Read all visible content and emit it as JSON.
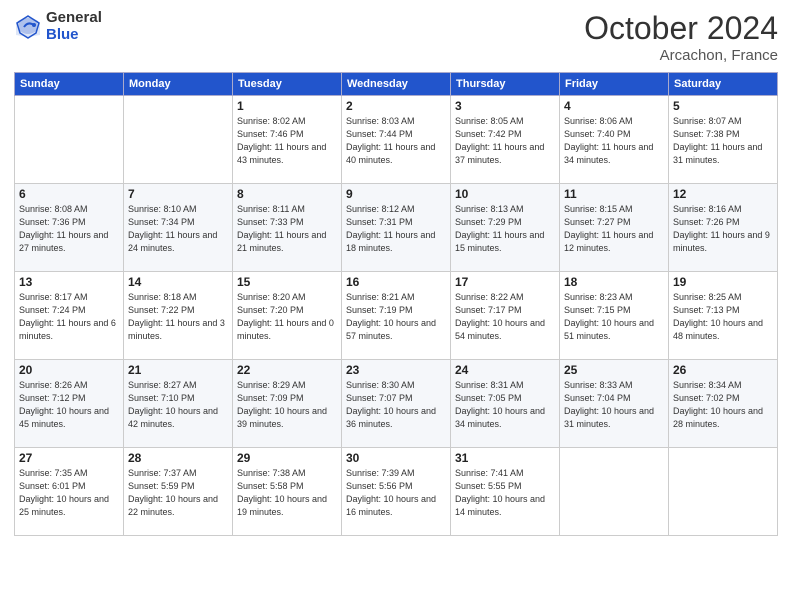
{
  "header": {
    "logo_general": "General",
    "logo_blue": "Blue",
    "month": "October 2024",
    "location": "Arcachon, France"
  },
  "days_of_week": [
    "Sunday",
    "Monday",
    "Tuesday",
    "Wednesday",
    "Thursday",
    "Friday",
    "Saturday"
  ],
  "weeks": [
    [
      {
        "day": "",
        "detail": ""
      },
      {
        "day": "",
        "detail": ""
      },
      {
        "day": "1",
        "detail": "Sunrise: 8:02 AM\nSunset: 7:46 PM\nDaylight: 11 hours and 43 minutes."
      },
      {
        "day": "2",
        "detail": "Sunrise: 8:03 AM\nSunset: 7:44 PM\nDaylight: 11 hours and 40 minutes."
      },
      {
        "day": "3",
        "detail": "Sunrise: 8:05 AM\nSunset: 7:42 PM\nDaylight: 11 hours and 37 minutes."
      },
      {
        "day": "4",
        "detail": "Sunrise: 8:06 AM\nSunset: 7:40 PM\nDaylight: 11 hours and 34 minutes."
      },
      {
        "day": "5",
        "detail": "Sunrise: 8:07 AM\nSunset: 7:38 PM\nDaylight: 11 hours and 31 minutes."
      }
    ],
    [
      {
        "day": "6",
        "detail": "Sunrise: 8:08 AM\nSunset: 7:36 PM\nDaylight: 11 hours and 27 minutes."
      },
      {
        "day": "7",
        "detail": "Sunrise: 8:10 AM\nSunset: 7:34 PM\nDaylight: 11 hours and 24 minutes."
      },
      {
        "day": "8",
        "detail": "Sunrise: 8:11 AM\nSunset: 7:33 PM\nDaylight: 11 hours and 21 minutes."
      },
      {
        "day": "9",
        "detail": "Sunrise: 8:12 AM\nSunset: 7:31 PM\nDaylight: 11 hours and 18 minutes."
      },
      {
        "day": "10",
        "detail": "Sunrise: 8:13 AM\nSunset: 7:29 PM\nDaylight: 11 hours and 15 minutes."
      },
      {
        "day": "11",
        "detail": "Sunrise: 8:15 AM\nSunset: 7:27 PM\nDaylight: 11 hours and 12 minutes."
      },
      {
        "day": "12",
        "detail": "Sunrise: 8:16 AM\nSunset: 7:26 PM\nDaylight: 11 hours and 9 minutes."
      }
    ],
    [
      {
        "day": "13",
        "detail": "Sunrise: 8:17 AM\nSunset: 7:24 PM\nDaylight: 11 hours and 6 minutes."
      },
      {
        "day": "14",
        "detail": "Sunrise: 8:18 AM\nSunset: 7:22 PM\nDaylight: 11 hours and 3 minutes."
      },
      {
        "day": "15",
        "detail": "Sunrise: 8:20 AM\nSunset: 7:20 PM\nDaylight: 11 hours and 0 minutes."
      },
      {
        "day": "16",
        "detail": "Sunrise: 8:21 AM\nSunset: 7:19 PM\nDaylight: 10 hours and 57 minutes."
      },
      {
        "day": "17",
        "detail": "Sunrise: 8:22 AM\nSunset: 7:17 PM\nDaylight: 10 hours and 54 minutes."
      },
      {
        "day": "18",
        "detail": "Sunrise: 8:23 AM\nSunset: 7:15 PM\nDaylight: 10 hours and 51 minutes."
      },
      {
        "day": "19",
        "detail": "Sunrise: 8:25 AM\nSunset: 7:13 PM\nDaylight: 10 hours and 48 minutes."
      }
    ],
    [
      {
        "day": "20",
        "detail": "Sunrise: 8:26 AM\nSunset: 7:12 PM\nDaylight: 10 hours and 45 minutes."
      },
      {
        "day": "21",
        "detail": "Sunrise: 8:27 AM\nSunset: 7:10 PM\nDaylight: 10 hours and 42 minutes."
      },
      {
        "day": "22",
        "detail": "Sunrise: 8:29 AM\nSunset: 7:09 PM\nDaylight: 10 hours and 39 minutes."
      },
      {
        "day": "23",
        "detail": "Sunrise: 8:30 AM\nSunset: 7:07 PM\nDaylight: 10 hours and 36 minutes."
      },
      {
        "day": "24",
        "detail": "Sunrise: 8:31 AM\nSunset: 7:05 PM\nDaylight: 10 hours and 34 minutes."
      },
      {
        "day": "25",
        "detail": "Sunrise: 8:33 AM\nSunset: 7:04 PM\nDaylight: 10 hours and 31 minutes."
      },
      {
        "day": "26",
        "detail": "Sunrise: 8:34 AM\nSunset: 7:02 PM\nDaylight: 10 hours and 28 minutes."
      }
    ],
    [
      {
        "day": "27",
        "detail": "Sunrise: 7:35 AM\nSunset: 6:01 PM\nDaylight: 10 hours and 25 minutes."
      },
      {
        "day": "28",
        "detail": "Sunrise: 7:37 AM\nSunset: 5:59 PM\nDaylight: 10 hours and 22 minutes."
      },
      {
        "day": "29",
        "detail": "Sunrise: 7:38 AM\nSunset: 5:58 PM\nDaylight: 10 hours and 19 minutes."
      },
      {
        "day": "30",
        "detail": "Sunrise: 7:39 AM\nSunset: 5:56 PM\nDaylight: 10 hours and 16 minutes."
      },
      {
        "day": "31",
        "detail": "Sunrise: 7:41 AM\nSunset: 5:55 PM\nDaylight: 10 hours and 14 minutes."
      },
      {
        "day": "",
        "detail": ""
      },
      {
        "day": "",
        "detail": ""
      }
    ]
  ]
}
